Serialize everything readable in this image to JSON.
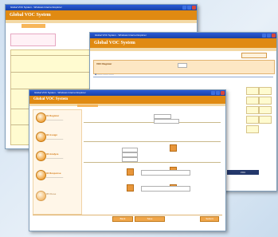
{
  "window_title": "Global VOC System - Windows Internet Explorer",
  "app_title": "Global VOC System",
  "back_window": {
    "tab": "TOP",
    "section_label": "VOC Search"
  },
  "middle_window": {
    "section_label": "VOC Register",
    "tag_label": "VOC"
  },
  "front_window": {
    "steps": [
      "01 Register",
      "02 Assign",
      "03 Analyze",
      "04 Response",
      "05 Close"
    ],
    "bottom_buttons": [
      "Back",
      "Save",
      "Submit"
    ]
  },
  "colors": {
    "header": "#e08a12",
    "accent_circle": "#f0a643",
    "titlebar": "#2a5bd7",
    "yellow_cells": "#fffbd0",
    "navy_tag": "#23376b"
  }
}
